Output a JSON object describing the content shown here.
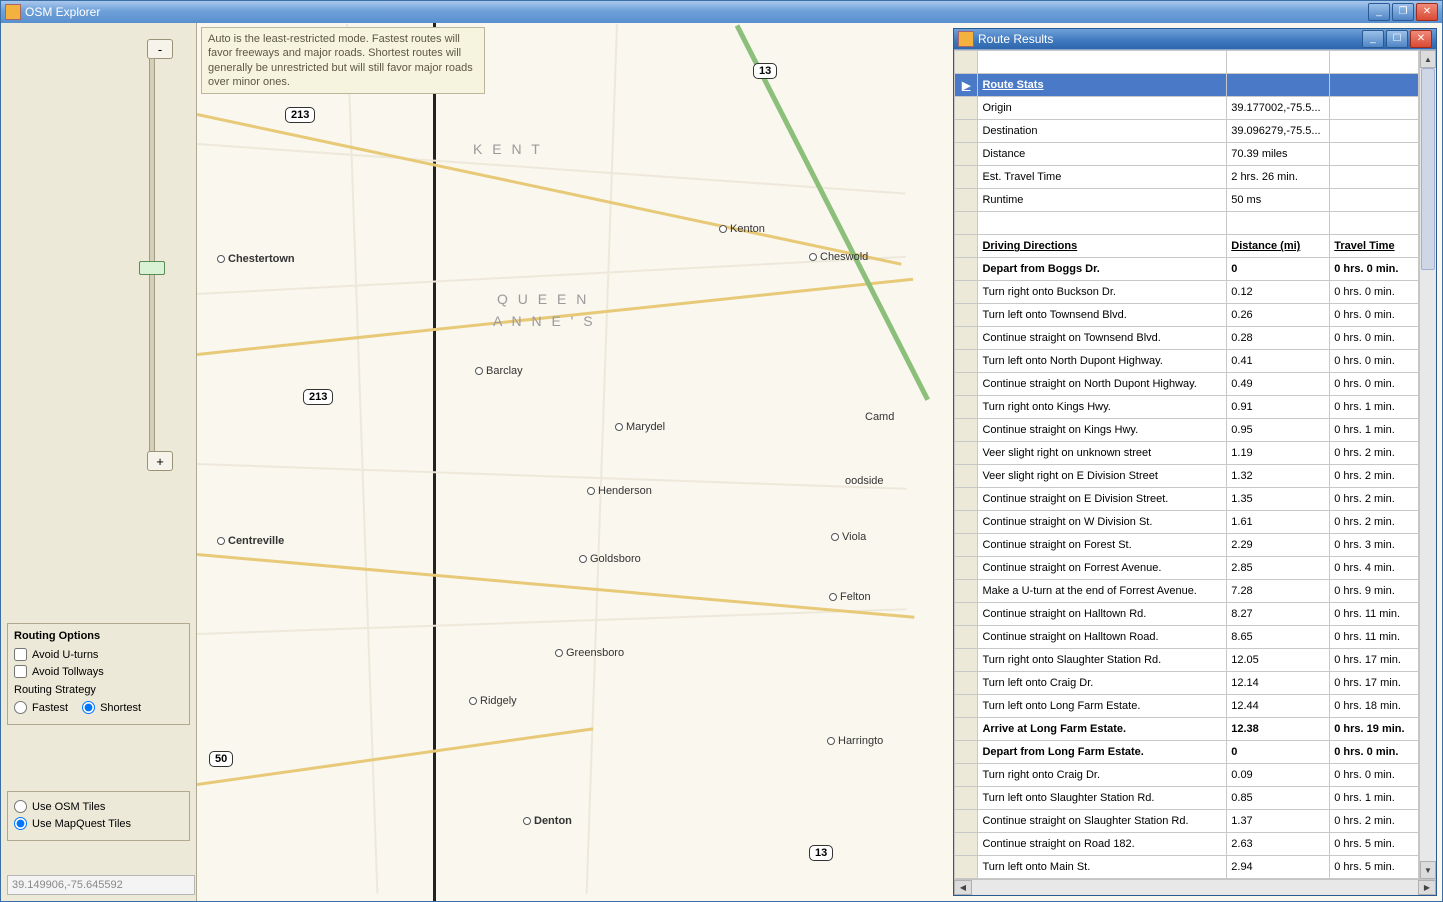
{
  "app_title": "OSM Explorer",
  "tooltip_text": "Auto is the least-restricted mode. Fastest routes will favor freeways and major roads. Shortest routes will generally be unrestricted but will still favor major roads over minor ones.",
  "zoom": {
    "minus": "-",
    "plus": "+"
  },
  "routing": {
    "title": "Routing Options",
    "avoid_uturns": "Avoid U-turns",
    "avoid_tollways": "Avoid Tollways",
    "strategy_label": "Routing Strategy",
    "fastest": "Fastest",
    "shortest": "Shortest"
  },
  "tiles": {
    "osm": "Use OSM Tiles",
    "mapquest": "Use MapQuest Tiles"
  },
  "coord_readout": "39.149906,-75.645592",
  "map": {
    "shields": [
      "213",
      "213",
      "13",
      "50",
      "13"
    ],
    "counties": [
      "K   E   N   T",
      "Q U E E N",
      "A N N E ' S"
    ],
    "towns": [
      "Chestertown",
      "Kenton",
      "Cheswold",
      "Barclay",
      "Marydel",
      "Camd",
      "Centreville",
      "Henderson",
      "oodside",
      "Viola",
      "Goldsboro",
      "Felton",
      "Greensboro",
      "Ridgely",
      "Harringto",
      "Denton"
    ]
  },
  "route_window": {
    "title": "Route Results",
    "stats_header": "Route Stats",
    "stats": [
      {
        "k": "Origin",
        "v": "39.177002,-75.5..."
      },
      {
        "k": "Destination",
        "v": "39.096279,-75.5..."
      },
      {
        "k": "Distance",
        "v": "70.39 miles"
      },
      {
        "k": "Est. Travel Time",
        "v": "2 hrs. 26 min."
      },
      {
        "k": "Runtime",
        "v": "50 ms"
      }
    ],
    "dir_headers": [
      "Driving Directions",
      "Distance (mi)",
      "Travel Time"
    ],
    "directions": [
      {
        "t": "Depart from Boggs Dr.",
        "d": "0",
        "tt": "0 hrs. 0 min.",
        "bold": true
      },
      {
        "t": "Turn right onto Buckson Dr.",
        "d": "0.12",
        "tt": "0 hrs. 0 min."
      },
      {
        "t": "Turn left onto Townsend Blvd.",
        "d": "0.26",
        "tt": "0 hrs. 0 min."
      },
      {
        "t": "Continue straight on Townsend Blvd.",
        "d": "0.28",
        "tt": "0 hrs. 0 min."
      },
      {
        "t": "Turn left onto North Dupont Highway.",
        "d": "0.41",
        "tt": "0 hrs. 0 min."
      },
      {
        "t": "Continue straight on North Dupont Highway.",
        "d": "0.49",
        "tt": "0 hrs. 0 min."
      },
      {
        "t": "Turn right onto Kings Hwy.",
        "d": "0.91",
        "tt": "0 hrs. 1 min."
      },
      {
        "t": "Continue straight on Kings Hwy.",
        "d": "0.95",
        "tt": "0 hrs. 1 min."
      },
      {
        "t": "Veer slight right on unknown street",
        "d": "1.19",
        "tt": "0 hrs. 2 min."
      },
      {
        "t": "Veer slight right on E Division Street",
        "d": "1.32",
        "tt": "0 hrs. 2 min."
      },
      {
        "t": "Continue straight on E Division Street.",
        "d": "1.35",
        "tt": "0 hrs. 2 min."
      },
      {
        "t": "Continue straight on W Division St.",
        "d": "1.61",
        "tt": "0 hrs. 2 min."
      },
      {
        "t": "Continue straight on Forest St.",
        "d": "2.29",
        "tt": "0 hrs. 3 min."
      },
      {
        "t": "Continue straight on Forrest Avenue.",
        "d": "2.85",
        "tt": "0 hrs. 4 min."
      },
      {
        "t": "Make a U-turn at the end of Forrest Avenue.",
        "d": "7.28",
        "tt": "0 hrs. 9 min."
      },
      {
        "t": "Continue straight on Halltown Rd.",
        "d": "8.27",
        "tt": "0 hrs. 11 min."
      },
      {
        "t": "Continue straight on Halltown Road.",
        "d": "8.65",
        "tt": "0 hrs. 11 min."
      },
      {
        "t": "Turn right onto Slaughter Station Rd.",
        "d": "12.05",
        "tt": "0 hrs. 17 min."
      },
      {
        "t": "Turn left onto Craig Dr.",
        "d": "12.14",
        "tt": "0 hrs. 17 min."
      },
      {
        "t": "Turn left onto Long Farm Estate.",
        "d": "12.44",
        "tt": "0 hrs. 18 min."
      },
      {
        "t": "Arrive at Long Farm Estate.",
        "d": "12.38",
        "tt": "0 hrs. 19 min.",
        "bold": true
      },
      {
        "t": "Depart from Long Farm Estate.",
        "d": "0",
        "tt": "0 hrs. 0 min.",
        "bold": true
      },
      {
        "t": "Turn right onto Craig Dr.",
        "d": "0.09",
        "tt": "0 hrs. 0 min."
      },
      {
        "t": "Turn left onto Slaughter Station Rd.",
        "d": "0.85",
        "tt": "0 hrs. 1 min."
      },
      {
        "t": "Continue straight on Slaughter Station Rd.",
        "d": "1.37",
        "tt": "0 hrs. 2 min."
      },
      {
        "t": "Continue straight on Road 182.",
        "d": "2.63",
        "tt": "0 hrs. 5 min."
      },
      {
        "t": "Turn left onto Main St.",
        "d": "2.94",
        "tt": "0 hrs. 5 min."
      }
    ]
  }
}
